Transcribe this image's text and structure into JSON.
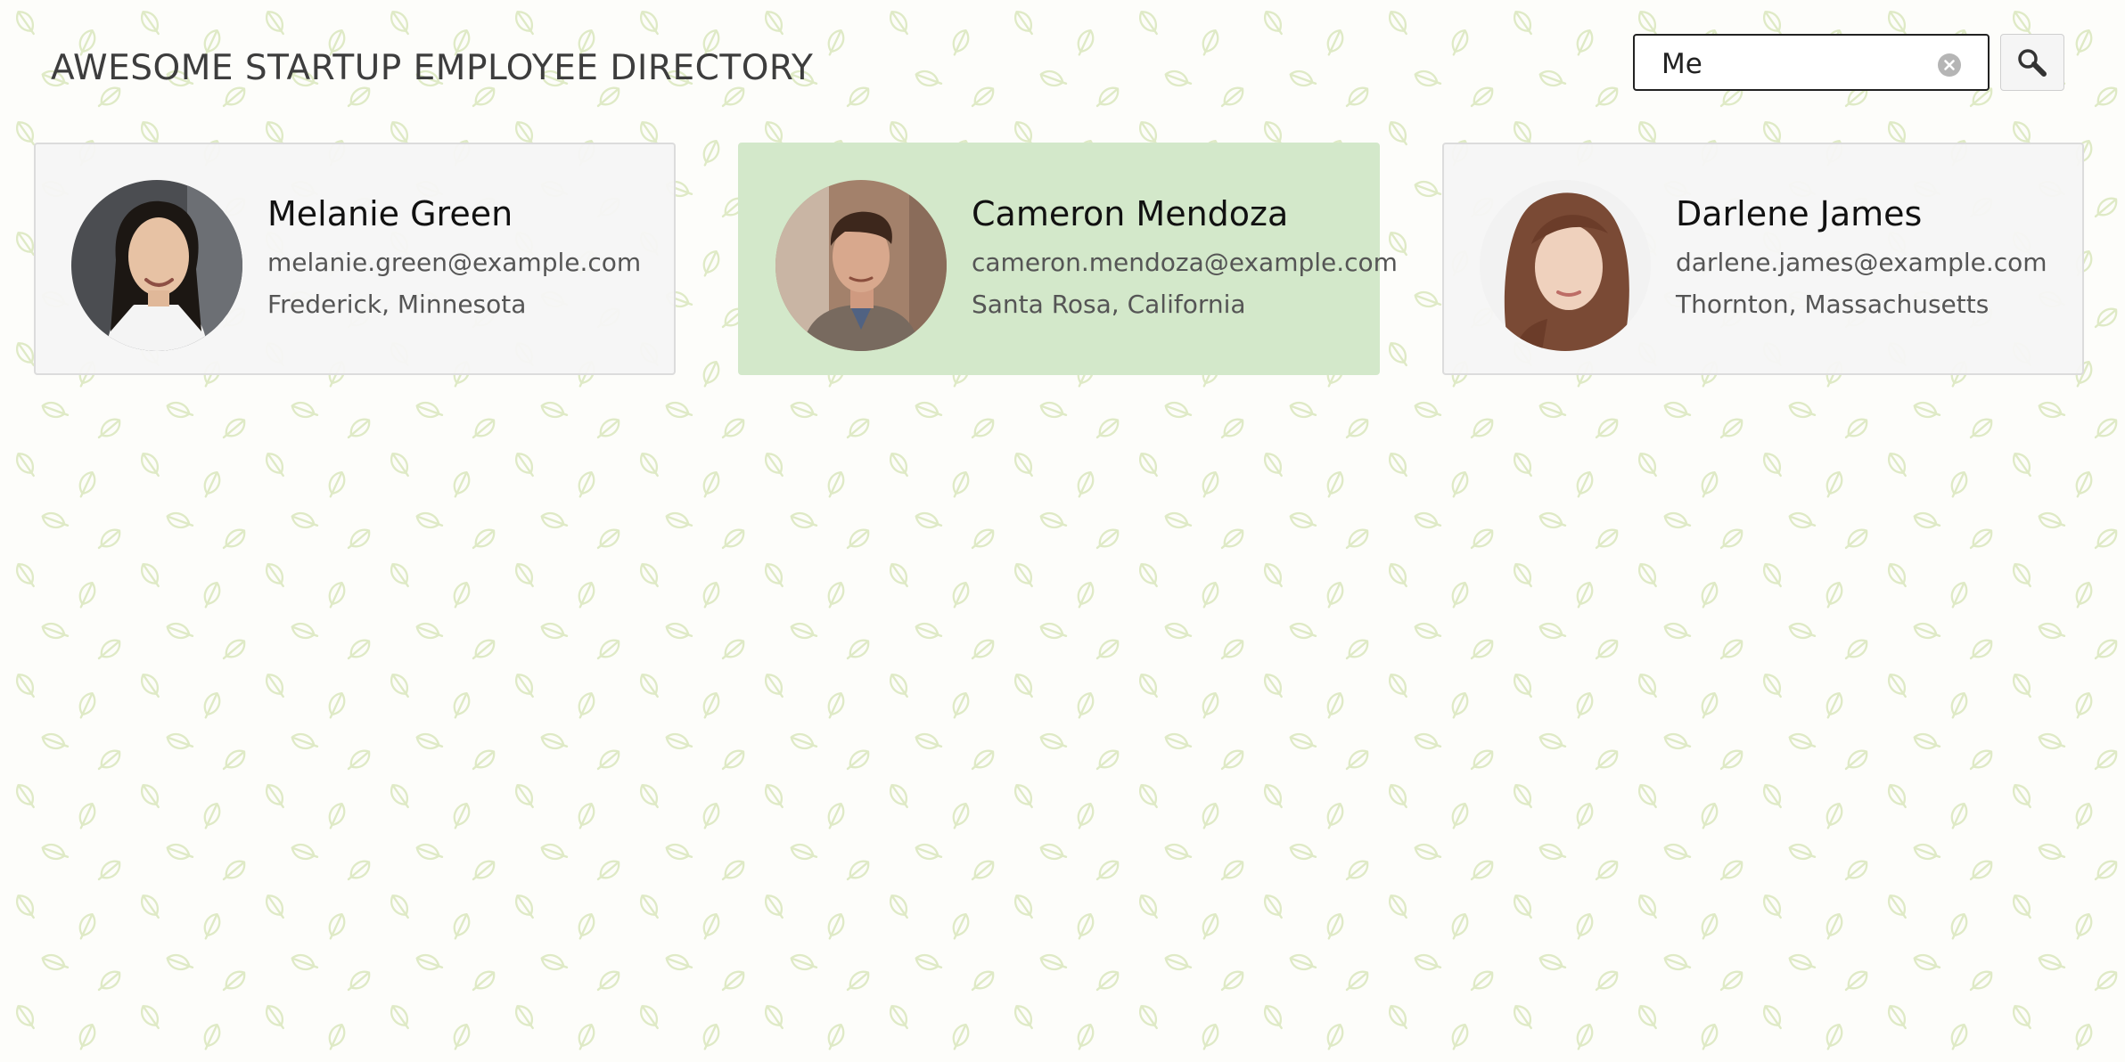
{
  "header": {
    "title": "AWESOME STARTUP EMPLOYEE DIRECTORY"
  },
  "search": {
    "value": "Me",
    "clear_icon": "clear-icon",
    "button_icon": "search-icon"
  },
  "employees": [
    {
      "name": "Melanie Green",
      "email": "melanie.green@example.com",
      "location": "Frederick, Minnesota",
      "highlighted": false
    },
    {
      "name": "Cameron Mendoza",
      "email": "cameron.mendoza@example.com",
      "location": "Santa Rosa, California",
      "highlighted": true
    },
    {
      "name": "Darlene James",
      "email": "darlene.james@example.com",
      "location": "Thornton, Massachusetts",
      "highlighted": false
    }
  ],
  "colors": {
    "highlight_card": "#d3e8ca",
    "default_card": "#f5f5f5",
    "leaf_pattern": "#e0ecc8",
    "title_text": "#3d3d3d"
  },
  "background": {
    "pattern_icon": "leaf-icon"
  }
}
